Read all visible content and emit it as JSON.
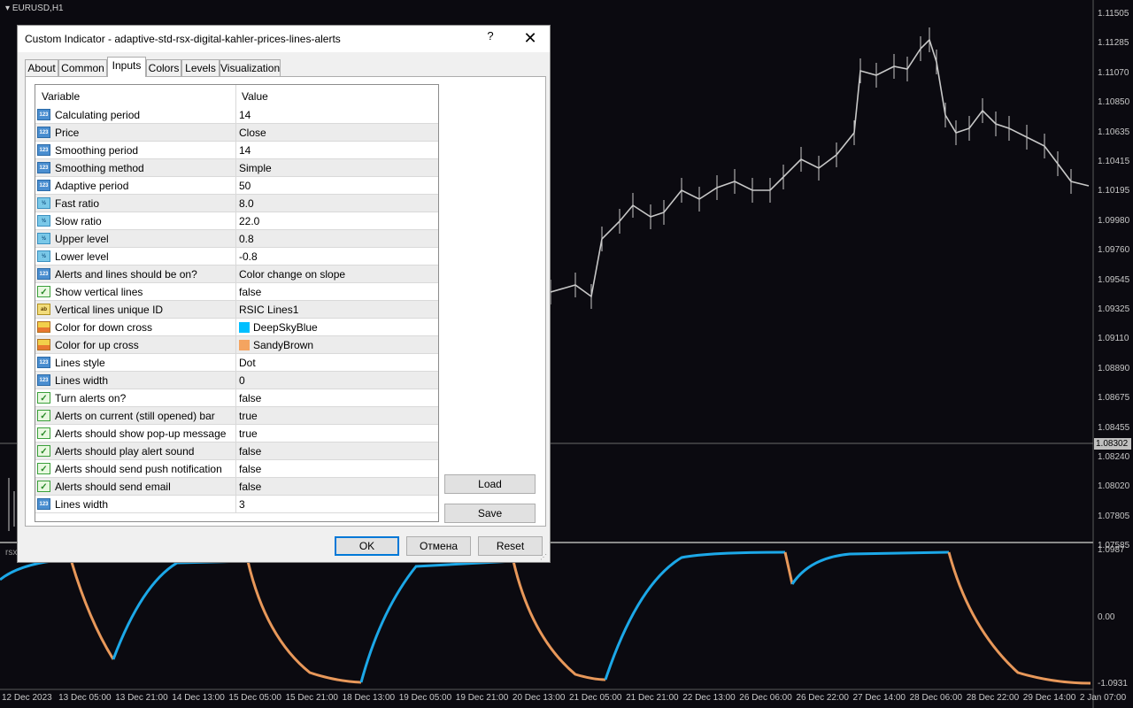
{
  "chart": {
    "symbol": "EURUSD,H1",
    "indicator_short": "rsx",
    "price_scale": [
      "1.11505",
      "1.11285",
      "1.11070",
      "1.10850",
      "1.10635",
      "1.10415",
      "1.10195",
      "1.09980",
      "1.09760",
      "1.09545",
      "1.09325",
      "1.09110",
      "1.08890",
      "1.08675",
      "1.08455",
      "1.08240",
      "1.08020",
      "1.07805",
      "1.07585"
    ],
    "current_price": "1.08302",
    "indicator_scale": [
      "1.0987",
      "0.00",
      "-1.0931"
    ],
    "time_axis": [
      "12 Dec 2023",
      "13 Dec 05:00",
      "13 Dec 21:00",
      "14 Dec 13:00",
      "15 Dec 05:00",
      "15 Dec 21:00",
      "18 Dec 13:00",
      "19 Dec 05:00",
      "19 Dec 21:00",
      "20 Dec 13:00",
      "21 Dec 05:00",
      "21 Dec 21:00",
      "22 Dec 13:00",
      "26 Dec 06:00",
      "26 Dec 22:00",
      "27 Dec 14:00",
      "28 Dec 06:00",
      "28 Dec 22:00",
      "29 Dec 14:00",
      "2 Jan 07:00"
    ],
    "colors": {
      "up": "#e8985a",
      "down": "#1ca8e8",
      "candles": "#c8c8c8",
      "background": "#0b0a10"
    }
  },
  "dialog": {
    "title": "Custom Indicator - adaptive-std-rsx-digital-kahler-prices-lines-alerts",
    "help": "?",
    "close": "✕",
    "tabs": [
      "About",
      "Common",
      "Inputs",
      "Colors",
      "Levels",
      "Visualization"
    ],
    "active_tab": "Inputs",
    "columns": {
      "variable": "Variable",
      "value": "Value"
    },
    "rows": [
      {
        "icon": "num",
        "icon_text": "123",
        "name": "Calculating period",
        "value": "14"
      },
      {
        "icon": "num",
        "icon_text": "123",
        "name": "Price",
        "value": "Close"
      },
      {
        "icon": "num",
        "icon_text": "123",
        "name": "Smoothing period",
        "value": "14"
      },
      {
        "icon": "num",
        "icon_text": "123",
        "name": "Smoothing method",
        "value": "Simple"
      },
      {
        "icon": "num",
        "icon_text": "123",
        "name": "Adaptive period",
        "value": "50"
      },
      {
        "icon": "dbl",
        "icon_text": "½",
        "name": "Fast ratio",
        "value": "8.0"
      },
      {
        "icon": "dbl",
        "icon_text": "½",
        "name": "Slow ratio",
        "value": "22.0"
      },
      {
        "icon": "dbl",
        "icon_text": "½",
        "name": "Upper level",
        "value": "0.8"
      },
      {
        "icon": "dbl",
        "icon_text": "½",
        "name": "Lower level",
        "value": "-0.8"
      },
      {
        "icon": "num",
        "icon_text": "123",
        "name": "Alerts and lines should be on?",
        "value": "Color change on slope"
      },
      {
        "icon": "bool",
        "icon_text": "",
        "name": "Show vertical lines",
        "value": "false"
      },
      {
        "icon": "str",
        "icon_text": "ab",
        "name": "Vertical lines unique ID",
        "value": "RSIC Lines1"
      },
      {
        "icon": "color",
        "icon_text": "",
        "name": "Color for down cross",
        "value": "DeepSkyBlue",
        "swatch": "#00bfff"
      },
      {
        "icon": "color",
        "icon_text": "",
        "name": "Color for up cross",
        "value": "SandyBrown",
        "swatch": "#f4a460"
      },
      {
        "icon": "num",
        "icon_text": "123",
        "name": "Lines style",
        "value": "Dot"
      },
      {
        "icon": "num",
        "icon_text": "123",
        "name": "Lines width",
        "value": "0"
      },
      {
        "icon": "bool",
        "icon_text": "",
        "name": "Turn alerts on?",
        "value": "false"
      },
      {
        "icon": "bool",
        "icon_text": "",
        "name": "Alerts on current (still opened) bar",
        "value": "true"
      },
      {
        "icon": "bool",
        "icon_text": "",
        "name": "Alerts should show pop-up message",
        "value": "true"
      },
      {
        "icon": "bool",
        "icon_text": "",
        "name": "Alerts should play alert sound",
        "value": "false"
      },
      {
        "icon": "bool",
        "icon_text": "",
        "name": "Alerts should send push notification",
        "value": "false"
      },
      {
        "icon": "bool",
        "icon_text": "",
        "name": "Alerts should send email",
        "value": "false"
      },
      {
        "icon": "num",
        "icon_text": "123",
        "name": "Lines width",
        "value": "3"
      }
    ],
    "buttons": {
      "load": "Load",
      "save": "Save",
      "ok": "OK",
      "cancel": "Отмена",
      "reset": "Reset"
    }
  }
}
